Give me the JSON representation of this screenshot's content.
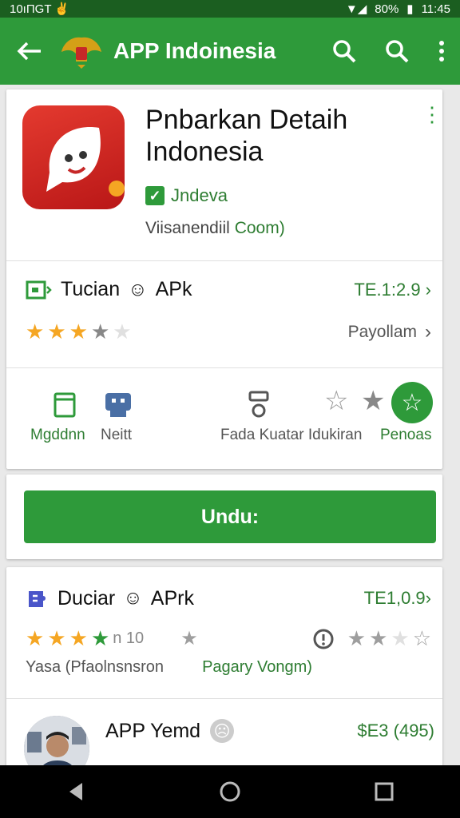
{
  "status_bar": {
    "left_text": "10ıΠGT ✌",
    "battery": "80%",
    "time": "11:45"
  },
  "app_bar": {
    "title": "APP Indoinesia"
  },
  "app_card": {
    "name": "Pnbarkan Detaih Indonesia",
    "verified_label": "Jndeva",
    "developer": "Viisanendiil",
    "developer_link": "Coom)"
  },
  "version_row": {
    "title_a": "Tucian",
    "title_b": "APk",
    "version": "TE.1:2.9 ›",
    "rating": 3.5,
    "rating_max": 5,
    "more_label": "Payollam"
  },
  "actions": {
    "a1": "Mgddnn",
    "a2": "Neitt",
    "a3": "Fada Kuatar Idukiran",
    "a4": "Penoas"
  },
  "download": {
    "label": "Undu:"
  },
  "list_card": {
    "item1": {
      "title_a": "Duciar",
      "title_b": "APrk",
      "version": "TE1,0.9›",
      "stars_label": "n 10",
      "sub_left": "Yasa (Pfaolnsnsron",
      "sub_right": "Pagary Vongm)"
    },
    "item2": {
      "title": "APP Yemd",
      "price": "$E3 (495)"
    }
  },
  "colors": {
    "primary": "#2e9a3a",
    "primary_dark": "#1b5e20",
    "star": "#f5a623"
  }
}
